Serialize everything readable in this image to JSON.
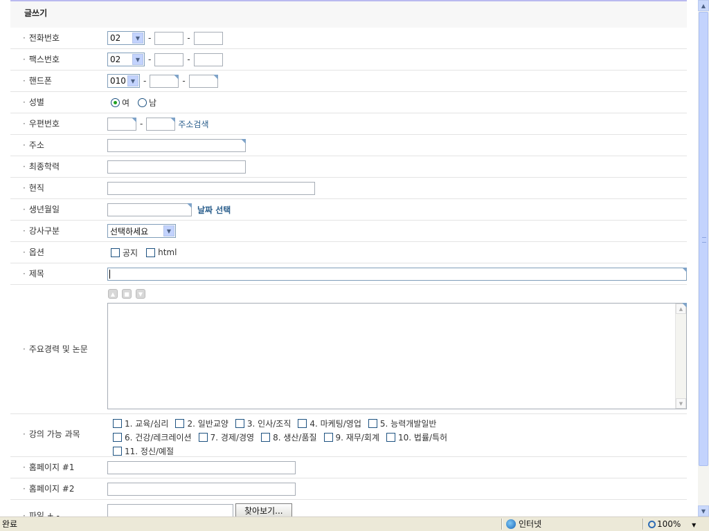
{
  "form": {
    "title": "글쓰기",
    "phone": {
      "label": "전화번호",
      "area": "02"
    },
    "fax": {
      "label": "팩스번호",
      "area": "02"
    },
    "mobile": {
      "label": "핸드폰",
      "prefix": "010"
    },
    "gender": {
      "label": "성별",
      "female": "여",
      "male": "남",
      "selected": "female"
    },
    "zipcode": {
      "label": "우편번호",
      "search_link": "주소검색"
    },
    "address": {
      "label": "주소"
    },
    "education": {
      "label": "최종학력"
    },
    "current_job": {
      "label": "현직"
    },
    "birthdate": {
      "label": "생년월일",
      "pick_link": "날짜 선택"
    },
    "instructor_type": {
      "label": "강사구분",
      "selected": "선택하세요"
    },
    "options": {
      "label": "옵션",
      "notice": "공지",
      "html": "html"
    },
    "subject": {
      "label": "제목"
    },
    "career": {
      "label": "주요경력 및 논문"
    },
    "courses": {
      "label": "강의 가능 과목",
      "items": [
        "1. 교육/심리",
        "2. 일반교양",
        "3. 인사/조직",
        "4. 마케팅/영업",
        "5. 능력개발일반",
        "6. 건강/레크레이션",
        "7. 경제/경영",
        "8. 생산/품질",
        "9. 재무/회계",
        "10. 법률/특허",
        "11. 정신/예절"
      ]
    },
    "homepage1": {
      "label": "홈페이지 #1"
    },
    "homepage2": {
      "label": "홈페이지 #2"
    },
    "file": {
      "label": "파일 + -",
      "browse": "찾아보기..."
    }
  },
  "statusbar": {
    "status": "완료",
    "zone": "인터넷",
    "zoom": "100%"
  },
  "icons": {
    "select_arrow": "chevron-down-icon",
    "globe": "globe-icon",
    "zoom": "magnifier-icon"
  }
}
